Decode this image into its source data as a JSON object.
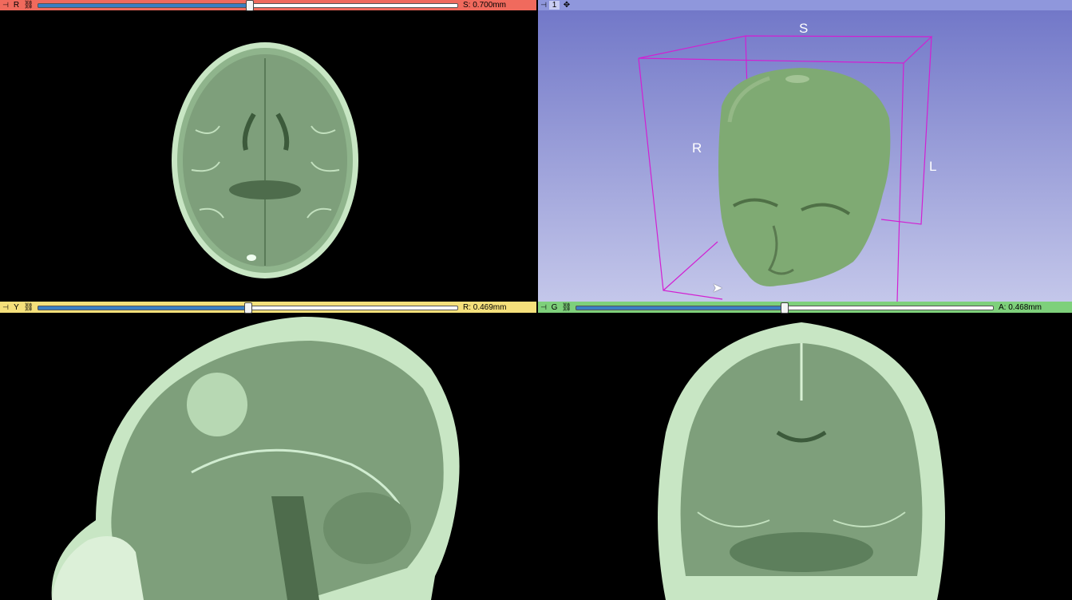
{
  "views": {
    "red": {
      "letter": "R",
      "value_text": "S: 0.700mm",
      "slider_fraction": 0.505,
      "bar_color": "#f06a5d"
    },
    "threed": {
      "letter": "1",
      "bar_color": "#8f97dc",
      "orientation": {
        "superior": "S",
        "right": "R",
        "left": "L"
      }
    },
    "yellow": {
      "letter": "Y",
      "value_text": "R: 0.469mm",
      "slider_fraction": 0.5,
      "bar_color": "#f5e07b"
    },
    "green": {
      "letter": "G",
      "value_text": "A: 0.468mm",
      "slider_fraction": 0.5,
      "bar_color": "#7ed07b"
    }
  },
  "icons": {
    "pin": "pin-icon",
    "link": "link-icon",
    "center": "center-view-icon",
    "cursor": "mouse-cursor-icon"
  },
  "colors": {
    "tissue": "#a8d4a6",
    "tissue_dark": "#5d7f5c",
    "bounding_box": "#d21fd2",
    "threed_bg_top": "#6f75c7",
    "threed_bg_bottom": "#c4c7ea",
    "head_surface": "#7faa73"
  }
}
